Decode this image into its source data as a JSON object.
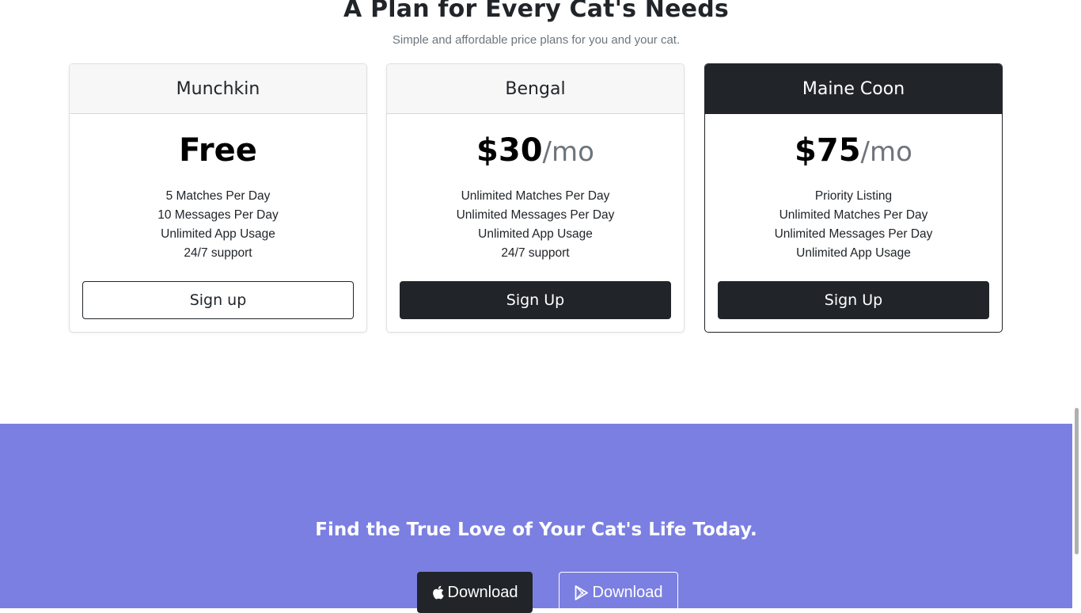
{
  "pricing": {
    "title": "A Plan for Every Cat's Needs",
    "subtitle": "Simple and affordable price plans for you and your cat.",
    "plans": [
      {
        "name": "Munchkin",
        "price": "Free",
        "period": "",
        "features": [
          "5 Matches Per Day",
          "10 Messages Per Day",
          "Unlimited App Usage",
          "24/7 support"
        ],
        "button_label": "Sign up"
      },
      {
        "name": "Bengal",
        "price": "$30",
        "period": "/mo",
        "features": [
          "Unlimited Matches Per Day",
          "Unlimited Messages Per Day",
          "Unlimited App Usage",
          "24/7 support"
        ],
        "button_label": "Sign Up"
      },
      {
        "name": "Maine Coon",
        "price": "$75",
        "period": "/mo",
        "features": [
          "Priority Listing",
          "Unlimited Matches Per Day",
          "Unlimited Messages Per Day",
          "Unlimited App Usage"
        ],
        "button_label": "Sign Up"
      }
    ]
  },
  "cta": {
    "title": "Find the True Love of Your Cat's Life Today.",
    "apple_button": {
      "label": "Download",
      "icon": "apple-icon"
    },
    "google_button": {
      "label": "Download",
      "icon": "google-play-icon"
    }
  },
  "colors": {
    "cta_background": "#7b7fe1",
    "dark": "#212529",
    "muted": "#6c757d"
  }
}
